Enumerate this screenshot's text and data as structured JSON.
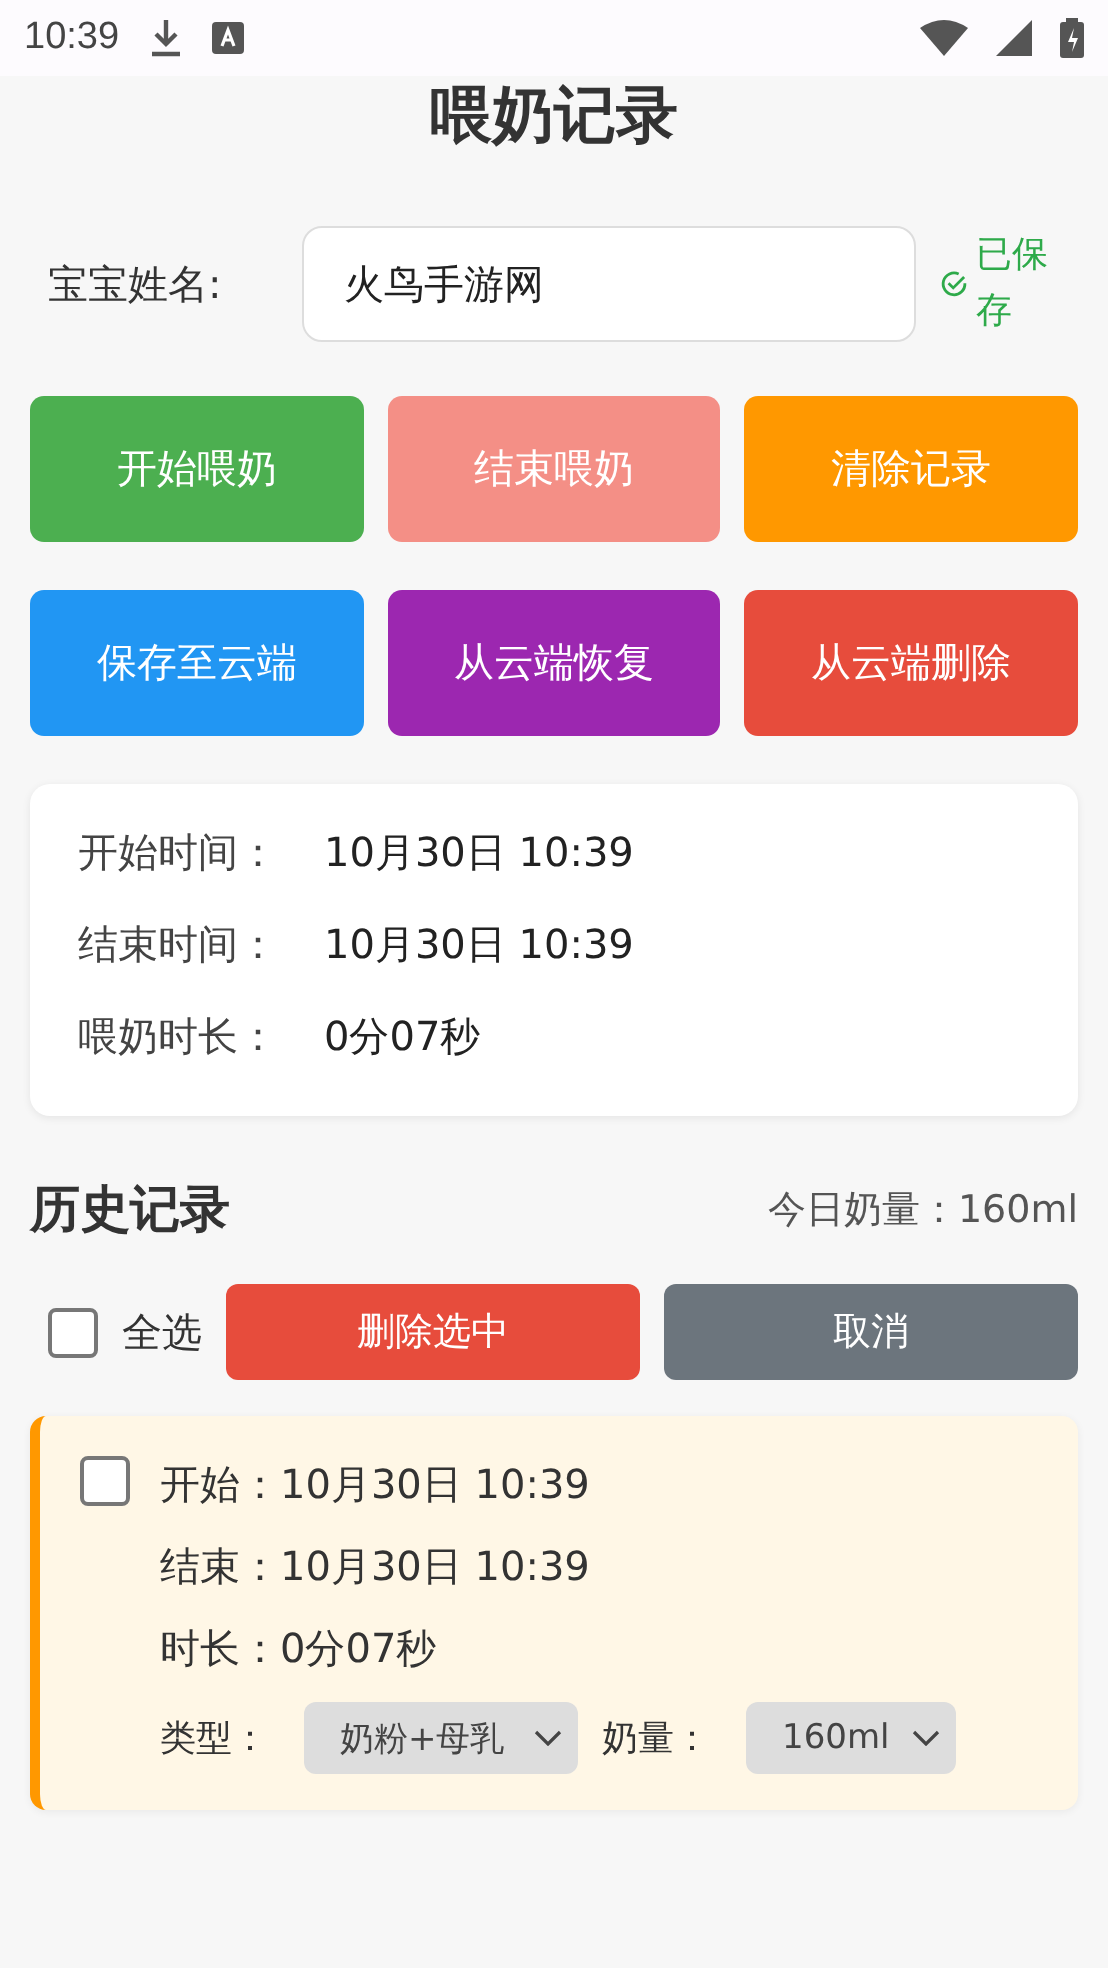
{
  "status_bar": {
    "time": "10:39"
  },
  "title": "喂奶记录",
  "name_field": {
    "label": "宝宝姓名:",
    "value": "火鸟手游网",
    "saved_text": "已保存"
  },
  "buttons": [
    {
      "label": "开始喂奶",
      "color": "#4caf50"
    },
    {
      "label": "结束喂奶",
      "color": "#f48f86"
    },
    {
      "label": "清除记录",
      "color": "#ff9800"
    },
    {
      "label": "保存至云端",
      "color": "#2196f3"
    },
    {
      "label": "从云端恢复",
      "color": "#9c27b0"
    },
    {
      "label": "从云端删除",
      "color": "#e74c3c"
    }
  ],
  "current": [
    {
      "label": "开始时间：",
      "value": "10月30日 10:39"
    },
    {
      "label": "结束时间：",
      "value": "10月30日 10:39"
    },
    {
      "label": "喂奶时长：",
      "value": "0分07秒"
    }
  ],
  "history": {
    "title": "历史记录",
    "today_total": "今日奶量：160ml",
    "select_all": {
      "label": "全选",
      "checked": false
    },
    "delete_button": "删除选中",
    "cancel_button": "取消",
    "records": [
      {
        "checked": false,
        "start": "开始：10月30日 10:39",
        "end": "结束：10月30日 10:39",
        "duration": "时长：0分07秒",
        "type_label": "类型：",
        "type_value": "奶粉+母乳",
        "amount_label": "奶量：",
        "amount_value": "160ml"
      }
    ]
  }
}
